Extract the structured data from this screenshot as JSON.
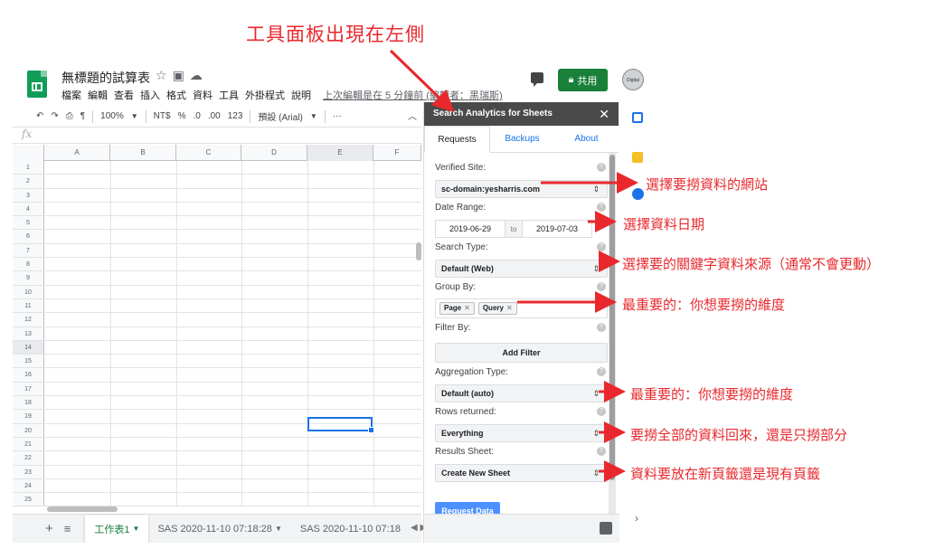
{
  "annotations": {
    "top": "工具面板出現在左側",
    "site": "選擇要撈資料的網站",
    "date": "選擇資料日期",
    "search_type": "選擇要的關鍵字資料來源（通常不會更動）",
    "group_by": "最重要的：你想要撈的維度",
    "aggregation": "最重要的：你想要撈的維度",
    "rows": "要撈全部的資料回來，還是只撈部分",
    "results_sheet": "資料要放在新頁籤還是現有頁籤"
  },
  "header": {
    "title": "無標題的試算表",
    "share_label": "共用",
    "avatar_text": "Digital Marketing",
    "last_edit": "上次編輯是在 5 分鐘前 (編輯者：黑瑞斯)"
  },
  "menu": [
    "檔案",
    "編輯",
    "查看",
    "插入",
    "格式",
    "資料",
    "工具",
    "外掛程式",
    "說明"
  ],
  "toolbar": {
    "zoom": "100%",
    "currency": "NT$",
    "percent": "%",
    "dec_less": ".0",
    "dec_more": ".00",
    "format_more": "123",
    "font": "預設 (Arial)",
    "more": "···"
  },
  "grid": {
    "fx_label": "fx",
    "columns": [
      "A",
      "B",
      "C",
      "D",
      "E",
      "F"
    ],
    "rows": [
      "1",
      "2",
      "3",
      "4",
      "5",
      "6",
      "7",
      "8",
      "9",
      "10",
      "11",
      "12",
      "13",
      "14",
      "15",
      "16",
      "17",
      "18",
      "19",
      "20",
      "21",
      "22",
      "23",
      "24",
      "25"
    ],
    "selected_cell": "E14"
  },
  "sheets": {
    "tabs": [
      "工作表1",
      "SAS 2020-11-10 07:18:28",
      "SAS 2020-11-10 07:18"
    ]
  },
  "panel": {
    "title": "Search Analytics for Sheets",
    "tabs": [
      "Requests",
      "Backups",
      "About"
    ],
    "verified_site_label": "Verified Site:",
    "verified_site_value": "sc-domain:yesharris.com",
    "date_range_label": "Date Range:",
    "date_from": "2019-06-29",
    "date_to_word": "to",
    "date_to": "2019-07-03",
    "search_type_label": "Search Type:",
    "search_type_value": "Default (Web)",
    "group_by_label": "Group By:",
    "group_chips": [
      "Page",
      "Query"
    ],
    "filter_by_label": "Filter By:",
    "add_filter_label": "Add Filter",
    "aggregation_label": "Aggregation Type:",
    "aggregation_value": "Default (auto)",
    "rows_label": "Rows returned:",
    "rows_value": "Everything",
    "results_label": "Results Sheet:",
    "results_value": "Create New Sheet",
    "request_button": "Request Data"
  },
  "colors": {
    "annotation_red": "#e8282d",
    "share_green": "#188038",
    "panel_header": "#4a4a4a",
    "request_blue": "#4d90fe"
  }
}
